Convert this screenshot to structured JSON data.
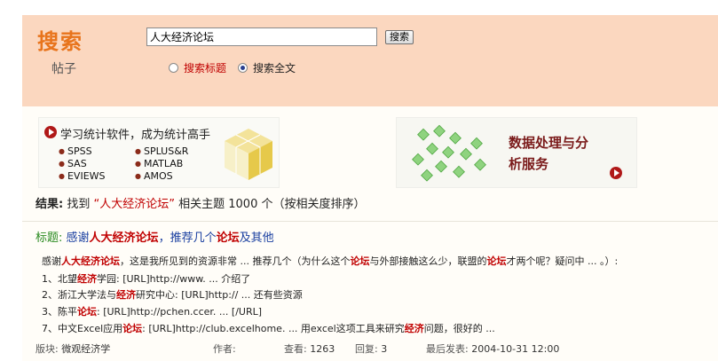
{
  "header": {
    "brand": "搜索",
    "sublabel": "帖子",
    "search_value": "人大经济论坛",
    "search_button": "搜索",
    "radio_title": "搜索标题",
    "radio_fulltext": "搜索全文",
    "selected": "fulltext"
  },
  "ads": {
    "left": {
      "title": "学习统计软件，成为统计高手",
      "software": [
        "SPSS",
        "SPLUS&R",
        "SAS",
        "MATLAB",
        "EVIEWS",
        "AMOS"
      ]
    },
    "right": {
      "title": "数据处理与分析服务"
    }
  },
  "result": {
    "prefix": "结果:",
    "found": "找到",
    "query": "“人大经济论坛”",
    "suffix": "相关主题 1000 个（按相关度排序）"
  },
  "post": {
    "label": "标题:",
    "title_a": "感谢",
    "title_kw1": "人大经济论坛",
    "title_b": "，推荐几个",
    "title_kw2": "论坛",
    "title_c": "及其他",
    "snippets": [
      [
        "感谢",
        "人大经济论坛",
        "，这是我所见到的资源非常 ... 推荐几个（为什么这个",
        "论坛",
        "与外部接触这么少，联盟的",
        "论坛",
        "才两个呢？疑问中 ... 。）:"
      ],
      [
        "1、北望",
        "经济",
        "学园: [URL]http://www. ... 介绍了",
        "",
        "",
        "",
        ""
      ],
      [
        "2、浙江大学法与",
        "经济",
        "研究中心: [URL]http:// ... 还有些资源",
        "",
        "",
        "",
        ""
      ],
      [
        "3、陈平",
        "论坛",
        ": [URL]http://pchen.ccer. ... [/URL]",
        "",
        "",
        "",
        ""
      ],
      [
        "7、中文Excel应用",
        "论坛",
        ": [URL]http://club.excelhome. ... 用excel这项工具来研究",
        "经济",
        "问题，很好的 ...",
        "",
        ""
      ]
    ],
    "meta": {
      "board_label": "版块:",
      "board": "微观经济学",
      "author_label": "作者:",
      "views_label": "查看:",
      "views": "1263",
      "replies_label": "回复:",
      "replies": "3",
      "last_label": "最后发表:",
      "last": "2004-10-31 12:00"
    }
  },
  "colors": {
    "header_bg": "#fbd7bf",
    "brand": "#e8741c",
    "keyword": "#c00000",
    "link": "#1a3fa0",
    "label_green": "#2a8a20"
  }
}
